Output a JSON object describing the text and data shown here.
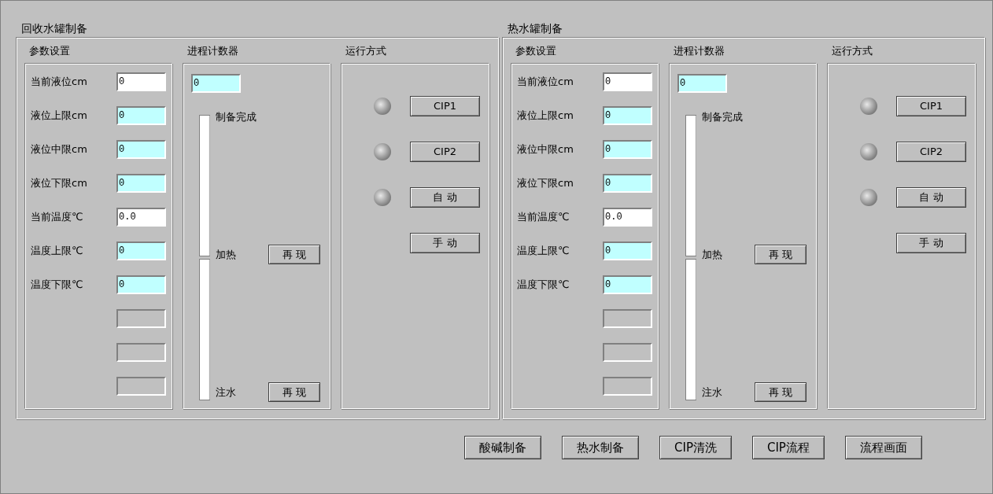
{
  "groups": [
    {
      "title": "回收水罐制备",
      "params": {
        "title": "参数设置",
        "fields": [
          {
            "kind": "reading",
            "label": "当前液位cm",
            "value": "0"
          },
          {
            "kind": "setpoint",
            "label": "液位上限cm",
            "value": "0"
          },
          {
            "kind": "setpoint",
            "label": "液位中限cm",
            "value": "0"
          },
          {
            "kind": "setpoint",
            "label": "液位下限cm",
            "value": "0"
          },
          {
            "kind": "reading",
            "label": "当前温度℃",
            "value": "0.0"
          },
          {
            "kind": "setpoint",
            "label": "温度上限℃",
            "value": "0"
          },
          {
            "kind": "setpoint",
            "label": "温度下限℃",
            "value": "0"
          },
          {
            "kind": "blank"
          },
          {
            "kind": "blank"
          },
          {
            "kind": "blank"
          }
        ]
      },
      "counter": {
        "title": "进程计数器",
        "value": "0",
        "stages": [
          {
            "label": "制备完成"
          },
          {
            "label": "加热",
            "button": "再 现"
          },
          {
            "label": "注水",
            "button": "再 现"
          }
        ]
      },
      "modes": {
        "title": "运行方式",
        "items": [
          {
            "kind": "lamp-button",
            "label": "CIP1",
            "lit": false
          },
          {
            "kind": "lamp-button",
            "label": "CIP2",
            "lit": false
          },
          {
            "kind": "lamp-button",
            "label": "自 动",
            "lit": false
          },
          {
            "kind": "button",
            "label": "手 动"
          }
        ]
      }
    },
    {
      "title": "热水罐制备",
      "params": {
        "title": "参数设置",
        "fields": [
          {
            "kind": "reading",
            "label": "当前液位cm",
            "value": "0"
          },
          {
            "kind": "setpoint",
            "label": "液位上限cm",
            "value": "0"
          },
          {
            "kind": "setpoint",
            "label": "液位中限cm",
            "value": "0"
          },
          {
            "kind": "setpoint",
            "label": "液位下限cm",
            "value": "0"
          },
          {
            "kind": "reading",
            "label": "当前温度℃",
            "value": "0.0"
          },
          {
            "kind": "setpoint",
            "label": "温度上限℃",
            "value": "0"
          },
          {
            "kind": "setpoint",
            "label": "温度下限℃",
            "value": "0"
          },
          {
            "kind": "blank"
          },
          {
            "kind": "blank"
          },
          {
            "kind": "blank"
          }
        ]
      },
      "counter": {
        "title": "进程计数器",
        "value": "0",
        "stages": [
          {
            "label": "制备完成"
          },
          {
            "label": "加热",
            "button": "再 现"
          },
          {
            "label": "注水",
            "button": "再 现"
          }
        ]
      },
      "modes": {
        "title": "运行方式",
        "items": [
          {
            "kind": "lamp-button",
            "label": "CIP1",
            "lit": false
          },
          {
            "kind": "lamp-button",
            "label": "CIP2",
            "lit": false
          },
          {
            "kind": "lamp-button",
            "label": "自 动",
            "lit": false
          },
          {
            "kind": "button",
            "label": "手 动"
          }
        ]
      }
    }
  ],
  "nav_buttons": [
    "酸碱制备",
    "热水制备",
    "CIP清洗",
    "CIP流程",
    "流程画面"
  ]
}
